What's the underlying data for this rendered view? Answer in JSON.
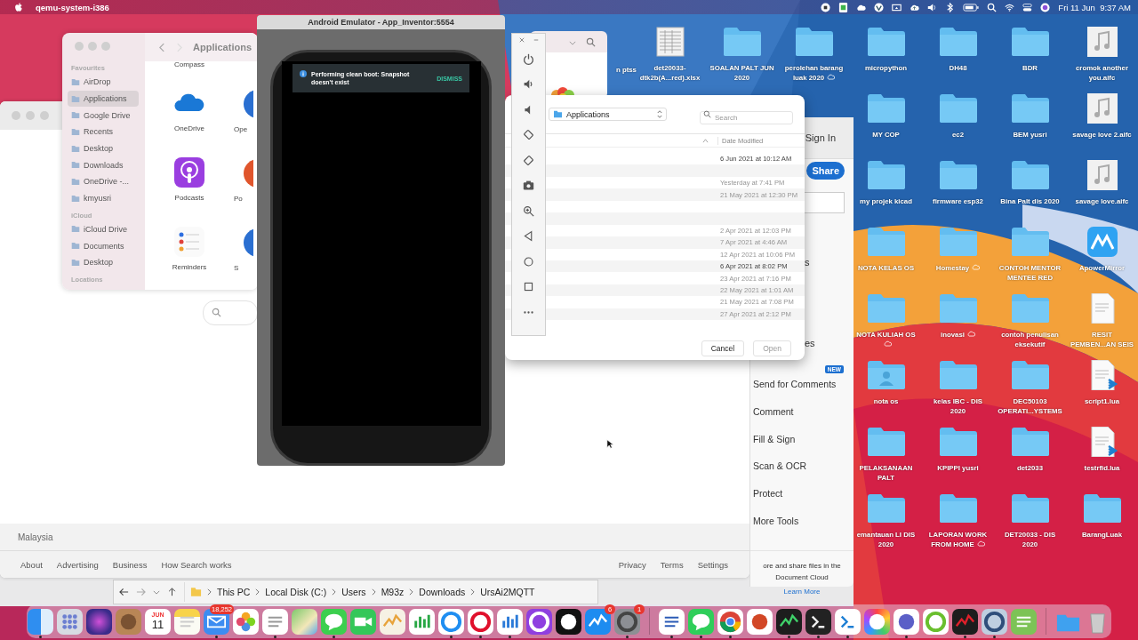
{
  "menu_bar": {
    "app_name": "qemu-system-i386",
    "clock": "Fri 11 Jun  9:37 AM"
  },
  "desktop_icons": [
    [
      {
        "label": "n ptss",
        "kind": "partial"
      },
      {
        "label": "det20033-dtk2b(A...red).xlsx",
        "kind": "spreadsheet"
      },
      {
        "label": "SOALAN PALT JUN 2020",
        "kind": "folder"
      },
      {
        "label": "perolehan barang luak 2020",
        "kind": "folder",
        "cloud": true
      },
      {
        "label": "micropython",
        "kind": "folder"
      },
      {
        "label": "DH48",
        "kind": "folder"
      },
      {
        "label": "BDR",
        "kind": "folder"
      },
      {
        "label": "cromok another you.aifc",
        "kind": "audio"
      }
    ],
    [
      {
        "label": "MY COP",
        "kind": "folder"
      },
      {
        "label": "ec2",
        "kind": "folder"
      },
      {
        "label": "BEM yusri",
        "kind": "folder"
      },
      {
        "label": "savage love 2.aifc",
        "kind": "audio"
      }
    ],
    [
      {
        "label": "my projek kicad",
        "kind": "folder"
      },
      {
        "label": "firmware esp32",
        "kind": "folder"
      },
      {
        "label": "Bina Palt dis 2020",
        "kind": "folder"
      },
      {
        "label": "savage love.aifc",
        "kind": "audio"
      }
    ],
    [
      {
        "label": "NOTA KELAS OS",
        "kind": "folder"
      },
      {
        "label": "Homestay",
        "kind": "folder",
        "cloud": true
      },
      {
        "label": "CONTOH MENTOR MENTEE RED",
        "kind": "folder"
      },
      {
        "label": "ApowerMirror",
        "kind": "app"
      }
    ],
    [
      {
        "label": "NOTA KULIAH OS",
        "kind": "folder",
        "cloud": true
      },
      {
        "label": "inovasi",
        "kind": "folder",
        "cloud": true
      },
      {
        "label": "contoh penulisan eksekutif",
        "kind": "folder"
      },
      {
        "label": "RESIT PEMBEN...AN SEIS",
        "kind": "document"
      }
    ],
    [
      {
        "label": "nota os",
        "kind": "shared_folder"
      },
      {
        "label": "kelas IBC - DIS 2020",
        "kind": "folder"
      },
      {
        "label": "DEC50103 OPERATI...YSTEMS",
        "kind": "folder"
      },
      {
        "label": "script1.lua",
        "kind": "code"
      }
    ],
    [
      {
        "label": "PELAKSANAAN PALT",
        "kind": "folder"
      },
      {
        "label": "KPIPPI yusri",
        "kind": "folder"
      },
      {
        "label": "det2033",
        "kind": "folder"
      },
      {
        "label": "testrfid.lua",
        "kind": "code"
      }
    ],
    [
      {
        "label": "emantauan LI DIS 2020",
        "kind": "folder"
      },
      {
        "label": "LAPORAN WORK FROM HOME",
        "kind": "folder",
        "cloud": true
      },
      {
        "label": "DET20033 - DIS 2020",
        "kind": "folder"
      },
      {
        "label": "BarangLuak",
        "kind": "folder"
      }
    ]
  ],
  "browser": {
    "country": "Malaysia",
    "links_left": [
      "About",
      "Advertising",
      "Business",
      "How Search works"
    ],
    "links_right": [
      "Privacy",
      "Terms",
      "Settings"
    ]
  },
  "explorer": {
    "path": [
      "This PC",
      "Local Disk (C:)",
      "Users",
      "M93z",
      "Downloads",
      "UrsAi2MQTT"
    ]
  },
  "acrobat": {
    "sign_in": "Sign In",
    "share": "Share",
    "tool_tails": [
      "s",
      "es"
    ],
    "tools": [
      {
        "label": "Send for Comments",
        "badge": "NEW"
      },
      {
        "label": "Comment"
      },
      {
        "label": "Fill & Sign"
      },
      {
        "label": "Scan & OCR"
      },
      {
        "label": "Protect"
      },
      {
        "label": "More Tools"
      }
    ],
    "promo": "ore and share files in the Document Cloud",
    "link": "Learn More"
  },
  "finder": {
    "title": "Applications",
    "sections": [
      {
        "header": "Favourites",
        "items": [
          {
            "label": "AirDrop",
            "selected": false
          },
          {
            "label": "Applications",
            "selected": true
          },
          {
            "label": "Google Drive",
            "selected": false
          },
          {
            "label": "Recents",
            "selected": false
          },
          {
            "label": "Desktop",
            "selected": false
          },
          {
            "label": "Downloads",
            "selected": false
          },
          {
            "label": "OneDrive -...",
            "selected": false
          },
          {
            "label": "kmyusri",
            "selected": false
          }
        ]
      },
      {
        "header": "iCloud",
        "items": [
          {
            "label": "iCloud Drive",
            "selected": false
          },
          {
            "label": "Documents",
            "selected": false
          },
          {
            "label": "Desktop",
            "selected": false
          }
        ]
      },
      {
        "header": "Locations"
      }
    ],
    "top_label": "Compass",
    "apps": [
      {
        "label": "OneDrive",
        "kind": "onedrive"
      },
      {
        "label": "Podcasts",
        "kind": "podcasts"
      },
      {
        "label": "Reminders",
        "kind": "reminders"
      }
    ],
    "second_column": [
      "Ope",
      "Po",
      "S"
    ]
  },
  "emulator": {
    "title": "Android Emulator - App_Inventor:5554",
    "message": "Performing clean boot: Snapshot doesn't exist",
    "action": "DISMISS",
    "toolbar": [
      {
        "kind": "power"
      },
      {
        "kind": "volume_up"
      },
      {
        "kind": "volume_down"
      },
      {
        "kind": "rotate_left"
      },
      {
        "kind": "rotate_right"
      },
      {
        "kind": "camera"
      },
      {
        "kind": "zoom"
      },
      {
        "kind": "back"
      },
      {
        "kind": "home"
      },
      {
        "kind": "overview"
      },
      {
        "kind": "more"
      }
    ]
  },
  "dialog": {
    "location": "Applications",
    "search_placeholder": "Search",
    "column": "Date Modified",
    "rows": [
      {
        "kind": "file",
        "date": "6 Jun 2021 at 10:12 AM",
        "disabled": false
      },
      {
        "kind": "blank"
      },
      {
        "kind": "file",
        "date": "Yesterday at 7:41 PM",
        "disabled": true
      },
      {
        "kind": "file",
        "date": "21 May 2021 at 12:30 PM",
        "disabled": true
      },
      {
        "kind": "blank"
      },
      {
        "kind": "blank"
      },
      {
        "kind": "file",
        "date": "2 Apr 2021 at 12:03 PM",
        "disabled": true
      },
      {
        "kind": "file",
        "date": "7 Apr 2021 at 4:46 AM",
        "disabled": true
      },
      {
        "kind": "file",
        "date": "12 Apr 2021 at 10:06 PM",
        "disabled": true
      },
      {
        "kind": "file",
        "date": "6 Apr 2021 at 8:02 PM",
        "disabled": false
      },
      {
        "kind": "file",
        "date": "23 Apr 2021 at 7:16 PM",
        "disabled": true
      },
      {
        "kind": "file",
        "date": "22 May 2021 at 1:01 AM",
        "disabled": true
      },
      {
        "kind": "file",
        "date": "21 May 2021 at 7:08 PM",
        "disabled": true
      },
      {
        "kind": "file",
        "date": "27 Apr 2021 at 2:12 PM",
        "disabled": true
      }
    ],
    "cancel": "Cancel",
    "open": {
      "label": "Open",
      "disabled": true
    }
  },
  "dock": {
    "groups": [
      [
        {
          "kind": "finder",
          "running": true
        },
        {
          "kind": "launchpad",
          "running": false
        },
        {
          "kind": "siri",
          "running": false
        },
        {
          "kind": "contacts",
          "running": false
        },
        {
          "kind": "calendar",
          "month": "JUN",
          "day": "11",
          "running": false
        },
        {
          "kind": "notes",
          "running": false
        },
        {
          "kind": "mail",
          "badge": "18,252",
          "running": true
        },
        {
          "kind": "photos",
          "running": false
        },
        {
          "kind": "reminders",
          "running": true
        },
        {
          "kind": "maps",
          "running": false
        },
        {
          "kind": "messages",
          "running": true
        },
        {
          "kind": "facetime",
          "running": false
        },
        {
          "kind": "pencil",
          "running": false
        },
        {
          "kind": "numbers",
          "running": false
        },
        {
          "kind": "safari",
          "running": true
        },
        {
          "kind": "opera",
          "running": true
        },
        {
          "kind": "keynote",
          "running": true
        },
        {
          "kind": "podcasts",
          "running": false
        },
        {
          "kind": "tv",
          "running": false
        },
        {
          "kind": "appstore",
          "badge": "6",
          "running": false
        },
        {
          "kind": "settings",
          "badge": "1",
          "running": true
        }
      ],
      [
        {
          "kind": "word",
          "running": true
        },
        {
          "kind": "whatsapp",
          "running": true
        },
        {
          "kind": "chrome",
          "running": true
        },
        {
          "kind": "powerpoint",
          "running": false
        },
        {
          "kind": "activity",
          "running": true
        },
        {
          "kind": "terminal",
          "running": true
        },
        {
          "kind": "vscode",
          "running": true
        },
        {
          "kind": "colorwheel",
          "running": false
        },
        {
          "kind": "teams",
          "running": true
        },
        {
          "kind": "torrent",
          "running": false
        },
        {
          "kind": "acrobat",
          "running": true
        },
        {
          "kind": "quicktime",
          "running": true
        },
        {
          "kind": "green",
          "running": false
        }
      ],
      [
        {
          "kind": "downloads",
          "running": false
        },
        {
          "kind": "trash",
          "running": false
        }
      ]
    ]
  }
}
